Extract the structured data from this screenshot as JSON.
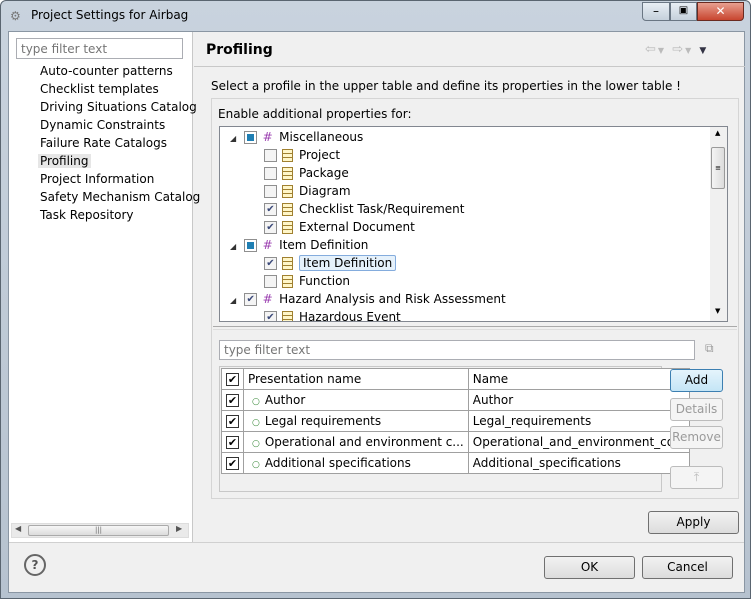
{
  "window": {
    "title": "Project Settings for Airbag"
  },
  "sidebar": {
    "filter_placeholder": "type filter text",
    "items": [
      {
        "label": "Auto-counter patterns"
      },
      {
        "label": "Checklist templates"
      },
      {
        "label": "Driving Situations Catalog"
      },
      {
        "label": "Dynamic Constraints"
      },
      {
        "label": "Failure Rate Catalogs"
      },
      {
        "label": "Profiling",
        "selected": true
      },
      {
        "label": "Project Information"
      },
      {
        "label": "Safety Mechanism Catalog"
      },
      {
        "label": "Task Repository"
      }
    ]
  },
  "page": {
    "title": "Profiling",
    "description": "Select a profile in the upper table and define its properties in the lower table !",
    "tree_label": "Enable additional properties for:",
    "tree": [
      {
        "label": "Miscellaneous",
        "level": 0,
        "state": "partial"
      },
      {
        "label": "Project",
        "level": 1,
        "state": "unchecked"
      },
      {
        "label": "Package",
        "level": 1,
        "state": "unchecked"
      },
      {
        "label": "Diagram",
        "level": 1,
        "state": "unchecked"
      },
      {
        "label": "Checklist Task/Requirement",
        "level": 1,
        "state": "checked"
      },
      {
        "label": "External Document",
        "level": 1,
        "state": "checked"
      },
      {
        "label": "Item Definition",
        "level": 0,
        "state": "partial"
      },
      {
        "label": "Item Definition",
        "level": 1,
        "state": "checked",
        "selected": true
      },
      {
        "label": "Function",
        "level": 1,
        "state": "unchecked"
      },
      {
        "label": "Hazard Analysis and Risk Assessment",
        "level": 0,
        "state": "checked"
      },
      {
        "label": "Hazardous Event",
        "level": 1,
        "state": "checked"
      }
    ],
    "filter_placeholder": "type filter text",
    "table": {
      "columns": [
        "Presentation name",
        "Name"
      ],
      "rows": [
        {
          "presentation": "Author",
          "name": "Author",
          "checked": true
        },
        {
          "presentation": "Legal requirements",
          "name": "Legal_requirements",
          "checked": true
        },
        {
          "presentation": "Operational and environment c...",
          "name": "Operational_and_environment_co...",
          "checked": true
        },
        {
          "presentation": "Additional specifications",
          "name": "Additional_specifications",
          "checked": true
        }
      ]
    },
    "buttons": {
      "add": "Add",
      "details": "Details",
      "remove": "Remove",
      "apply": "Apply"
    }
  },
  "footer": {
    "ok": "OK",
    "cancel": "Cancel",
    "help": "?"
  }
}
